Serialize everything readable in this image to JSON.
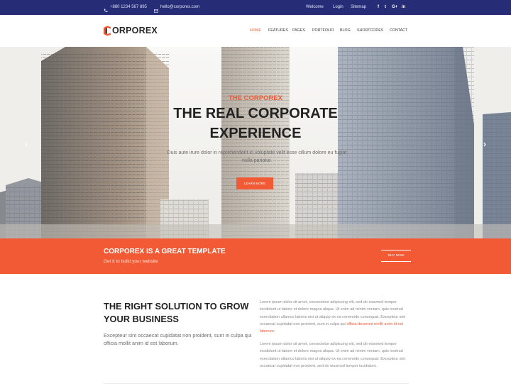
{
  "colors": {
    "brand": "#262d76",
    "accent": "#f25a35",
    "text": "#222222"
  },
  "topbar": {
    "phone": "+880 1234 567 895",
    "email": "hello@corporex.com",
    "links": [
      "Welcome",
      "Login",
      "Sitemap"
    ],
    "social": [
      {
        "icon": "facebook-icon",
        "glyph": "f"
      },
      {
        "icon": "twitter-icon",
        "glyph": "t"
      },
      {
        "icon": "google-plus-icon",
        "glyph": "G+"
      },
      {
        "icon": "linkedin-icon",
        "glyph": "in"
      }
    ]
  },
  "header": {
    "logo_text": "ORPOREX",
    "nav": [
      "HOME",
      "FEATURES",
      "PAGES",
      "PORTFOLIO",
      "BLOG",
      "SHORTCODES",
      "CONTACT"
    ],
    "active_nav": "HOME"
  },
  "hero": {
    "kicker": "THE CORPOREX",
    "title_line1": "THE REAL CORPORATE",
    "title_line2": "EXPERIENCE",
    "subtitle": "Duis aute irure dolor in reprehenderit in voluptate velit esse cillum dolore eu fugiat nulla pariatur.",
    "button": "LEARN MORE",
    "prev_icon": "chevron-left-icon",
    "next_icon": "chevron-right-icon"
  },
  "cta": {
    "title": "CORPOREX IS A GREAT TEMPLATE",
    "subtitle": "Get it to build your website",
    "button": "BUY NOW"
  },
  "content": {
    "title": "THE RIGHT SOLUTION TO GROW YOUR BUSINESS",
    "lead": "Excepteur sint occaecat cupidatat non proident, sunt in culpa qui officia mollit anim id est laborum.",
    "para1_a": "Lorem ipsum dolor sit amet, consectetur adipiscing elit, sed do eiusmod tempor incididunt ut labore et dolore magna aliqua. Ut enim ad minim veniam, quis nostrud exercitation ullamco laboris nisi ut aliquip ex ea commodo consequat. Excepteur sint occaecat cupidatat non proident, sunt in culpa qui ",
    "para1_b": "officia deserunt mollit anim id est laborum.",
    "para2": "Lorem ipsum dolor sit amet, consectetur adipiscing elit, sed do eiusmod tempor incididunt ut labore et dolore magna aliqua. Ut enim ad minim veniam, quis nostrud exercitation ullamco laboris nisi ut aliquip ex ea commodo consequat. Excepteur sint occaecat cupidatat non proident, sed do eiusmod tempor incididunt."
  }
}
